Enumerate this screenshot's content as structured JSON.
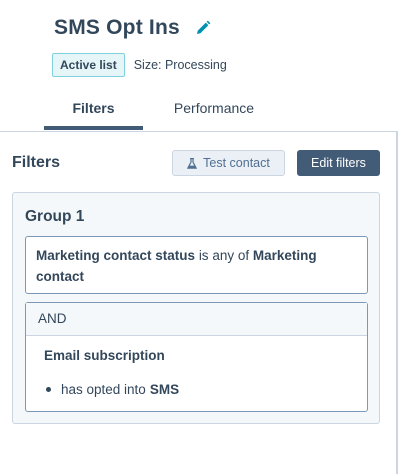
{
  "list": {
    "title": "SMS Opt Ins",
    "status_badge": "Active list",
    "size_text": "Size: Processing"
  },
  "tabs": [
    {
      "label": "Filters",
      "active": true
    },
    {
      "label": "Performance",
      "active": false
    }
  ],
  "panel": {
    "title": "Filters",
    "test_contact_label": "Test contact",
    "edit_filters_label": "Edit filters"
  },
  "group": {
    "title": "Group 1",
    "filter1": {
      "property": "Marketing contact status",
      "operator": "is any of",
      "value": "Marketing contact"
    },
    "connector": "AND",
    "filter2": {
      "title": "Email subscription",
      "condition": "has opted into",
      "value": "SMS"
    }
  },
  "colors": {
    "text": "#33475b",
    "primary_button": "#425b76",
    "badge_border": "#7fd1de",
    "edit_icon": "#0091ae"
  },
  "icons": {
    "edit": "pencil-icon",
    "test_contact": "flask-icon"
  }
}
